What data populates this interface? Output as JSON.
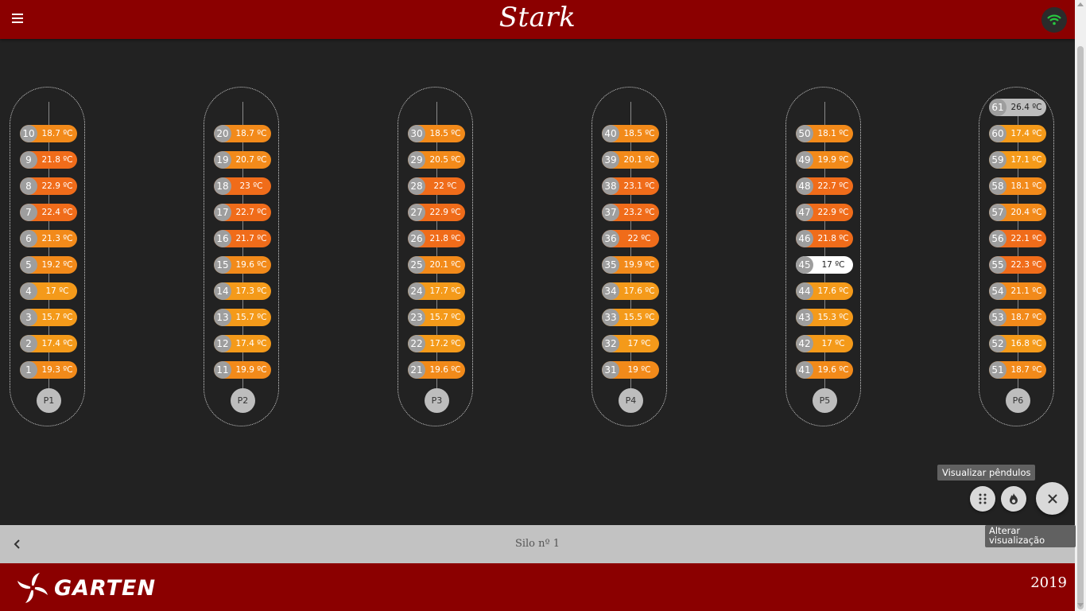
{
  "header": {
    "app_title": "Stark"
  },
  "pendulums": [
    {
      "label": "P1",
      "sensors": [
        {
          "n": "10",
          "t": "18.7 ºC"
        },
        {
          "n": "9",
          "t": "21.8 ºC"
        },
        {
          "n": "8",
          "t": "22.9 ºC"
        },
        {
          "n": "7",
          "t": "22.4 ºC"
        },
        {
          "n": "6",
          "t": "21.3 ºC"
        },
        {
          "n": "5",
          "t": "19.2 ºC"
        },
        {
          "n": "4",
          "t": "17 ºC"
        },
        {
          "n": "3",
          "t": "15.7 ºC"
        },
        {
          "n": "2",
          "t": "17.4 ºC"
        },
        {
          "n": "1",
          "t": "19.3 ºC"
        }
      ]
    },
    {
      "label": "P2",
      "sensors": [
        {
          "n": "20",
          "t": "18.7 ºC"
        },
        {
          "n": "19",
          "t": "20.7 ºC"
        },
        {
          "n": "18",
          "t": "23 ºC"
        },
        {
          "n": "17",
          "t": "22.7 ºC"
        },
        {
          "n": "16",
          "t": "21.7 ºC"
        },
        {
          "n": "15",
          "t": "19.6 ºC"
        },
        {
          "n": "14",
          "t": "17.3 ºC"
        },
        {
          "n": "13",
          "t": "15.7 ºC"
        },
        {
          "n": "12",
          "t": "17.4 ºC"
        },
        {
          "n": "11",
          "t": "19.9 ºC"
        }
      ]
    },
    {
      "label": "P3",
      "sensors": [
        {
          "n": "30",
          "t": "18.5 ºC"
        },
        {
          "n": "29",
          "t": "20.5 ºC"
        },
        {
          "n": "28",
          "t": "22 ºC"
        },
        {
          "n": "27",
          "t": "22.9 ºC"
        },
        {
          "n": "26",
          "t": "21.8 ºC"
        },
        {
          "n": "25",
          "t": "20.1 ºC"
        },
        {
          "n": "24",
          "t": "17.7 ºC"
        },
        {
          "n": "23",
          "t": "15.7 ºC"
        },
        {
          "n": "22",
          "t": "17.2 ºC"
        },
        {
          "n": "21",
          "t": "19.6 ºC"
        }
      ]
    },
    {
      "label": "P4",
      "sensors": [
        {
          "n": "40",
          "t": "18.5 ºC"
        },
        {
          "n": "39",
          "t": "20.1 ºC"
        },
        {
          "n": "38",
          "t": "23.1 ºC"
        },
        {
          "n": "37",
          "t": "23.2 ºC"
        },
        {
          "n": "36",
          "t": "22 ºC"
        },
        {
          "n": "35",
          "t": "19.9 ºC"
        },
        {
          "n": "34",
          "t": "17.6 ºC"
        },
        {
          "n": "33",
          "t": "15.5 ºC"
        },
        {
          "n": "32",
          "t": "17 ºC"
        },
        {
          "n": "31",
          "t": "19 ºC"
        }
      ]
    },
    {
      "label": "P5",
      "sensors": [
        {
          "n": "50",
          "t": "18.1 ºC"
        },
        {
          "n": "49",
          "t": "19.9 ºC"
        },
        {
          "n": "48",
          "t": "22.7 ºC"
        },
        {
          "n": "47",
          "t": "22.9 ºC"
        },
        {
          "n": "46",
          "t": "21.8 ºC"
        },
        {
          "n": "45",
          "t": "17 ºC"
        },
        {
          "n": "44",
          "t": "17.6 ºC"
        },
        {
          "n": "43",
          "t": "15.3 ºC"
        },
        {
          "n": "42",
          "t": "17 ºC"
        },
        {
          "n": "41",
          "t": "19.6 ºC"
        }
      ]
    },
    {
      "label": "P6",
      "sensors": [
        {
          "n": "61",
          "t": "26.4 ºC"
        },
        {
          "n": "60",
          "t": "17.4 ºC"
        },
        {
          "n": "59",
          "t": "17.1 ºC"
        },
        {
          "n": "58",
          "t": "18.1 ºC"
        },
        {
          "n": "57",
          "t": "20.4 ºC"
        },
        {
          "n": "56",
          "t": "22.1 ºC"
        },
        {
          "n": "55",
          "t": "22.3 ºC"
        },
        {
          "n": "54",
          "t": "21.1 ºC"
        },
        {
          "n": "53",
          "t": "18.7 ºC"
        },
        {
          "n": "52",
          "t": "16.8 ºC"
        },
        {
          "n": "51",
          "t": "18.7 ºC"
        }
      ]
    }
  ],
  "fab": {
    "tooltip_pendulums": "Visualizar pêndulos",
    "tooltip_view": "Alterar visualização"
  },
  "bottom": {
    "silo_label": "Silo nº 1"
  },
  "footer": {
    "logo_text": "GARTEN",
    "year": "2019"
  },
  "colors": {
    "header_bg": "#8b0000",
    "page_bg": "#222222",
    "sensor_number_bg": "#9e9e9e"
  }
}
